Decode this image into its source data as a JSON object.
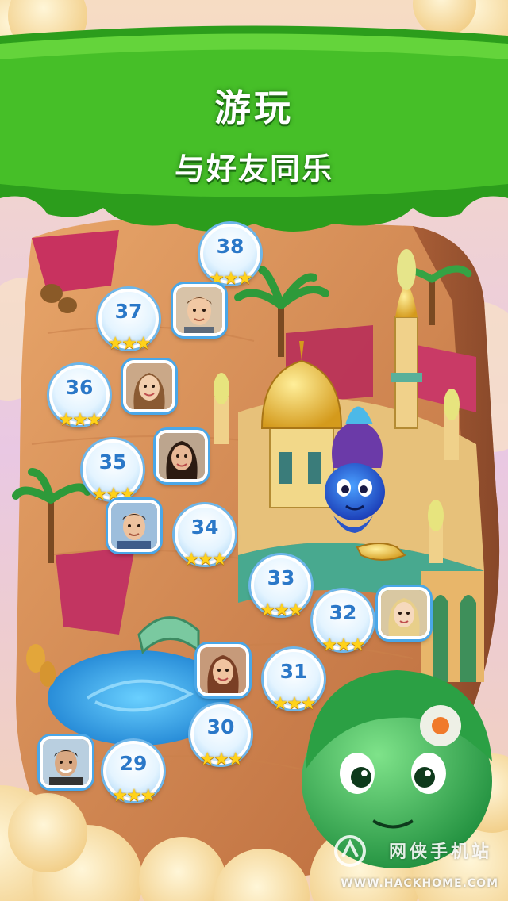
{
  "banner": {
    "title": "游玩",
    "subtitle": "与好友同乐",
    "color": "#3aae1f"
  },
  "levels": [
    {
      "number": "38",
      "stars": "★★★"
    },
    {
      "number": "37",
      "stars": "★★★"
    },
    {
      "number": "36",
      "stars": "★★★"
    },
    {
      "number": "35",
      "stars": "★★★"
    },
    {
      "number": "34",
      "stars": "★★★"
    },
    {
      "number": "33",
      "stars": "★★★"
    },
    {
      "number": "32",
      "stars": "★★★"
    },
    {
      "number": "31",
      "stars": "★★★"
    },
    {
      "number": "30",
      "stars": "★★★"
    },
    {
      "number": "29",
      "stars": "★★★"
    }
  ],
  "friends_count": 7,
  "watermark": {
    "text": "网侠手机站",
    "url": "WWW.HACKHOME.COM"
  }
}
